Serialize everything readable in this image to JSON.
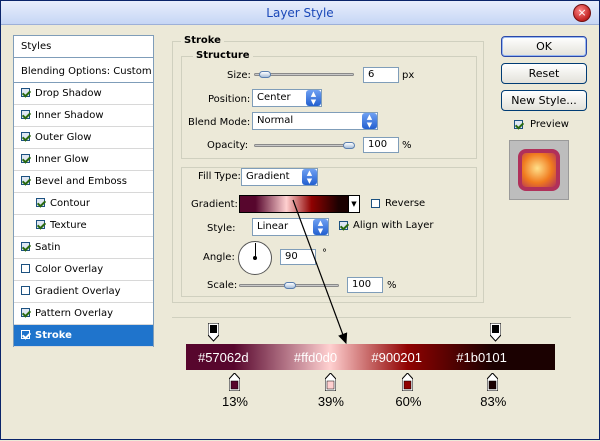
{
  "window": {
    "title": "Layer Style",
    "close_glyph": "×"
  },
  "styles_panel": {
    "heading": "Styles",
    "blending": "Blending Options: Custom",
    "items": [
      {
        "label": "Drop Shadow",
        "checked": true
      },
      {
        "label": "Inner Shadow",
        "checked": true
      },
      {
        "label": "Outer Glow",
        "checked": true
      },
      {
        "label": "Inner Glow",
        "checked": true
      },
      {
        "label": "Bevel and Emboss",
        "checked": true
      },
      {
        "label": "Contour",
        "checked": true
      },
      {
        "label": "Texture",
        "checked": true
      },
      {
        "label": "Satin",
        "checked": true
      },
      {
        "label": "Color Overlay",
        "checked": false
      },
      {
        "label": "Gradient Overlay",
        "checked": false
      },
      {
        "label": "Pattern Overlay",
        "checked": true
      },
      {
        "label": "Stroke",
        "checked": true,
        "selected": true
      }
    ]
  },
  "stroke": {
    "title": "Stroke",
    "structure": {
      "legend": "Structure",
      "size_label": "Size:",
      "size_value": "6",
      "size_unit": "px",
      "size_level": 0.05,
      "position_label": "Position:",
      "position_value": "Center",
      "blend_label": "Blend Mode:",
      "blend_value": "Normal",
      "opacity_label": "Opacity:",
      "opacity_value": "100",
      "opacity_unit": "%",
      "opacity_level": 1.0
    },
    "fill": {
      "fill_type_label": "Fill Type:",
      "fill_type_value": "Gradient",
      "gradient_label": "Gradient:",
      "reverse_label": "Reverse",
      "reverse_checked": false,
      "style_label": "Style:",
      "style_value": "Linear",
      "align_label": "Align with Layer",
      "align_checked": true,
      "angle_label": "Angle:",
      "angle_value": "90",
      "angle_unit": "°",
      "scale_label": "Scale:",
      "scale_value": "100",
      "scale_unit": "%",
      "scale_level": 0.5
    }
  },
  "buttons": {
    "ok": "OK",
    "reset": "Reset",
    "new_style": "New Style...",
    "preview": "Preview",
    "preview_checked": true
  },
  "gradient_editor": {
    "stops": [
      {
        "hex": "#57062d",
        "color": "#57062d",
        "pct": "13%",
        "location": 13
      },
      {
        "hex": "#ffd0d0",
        "color": "#ffd0d0",
        "pct": "39%",
        "location": 39
      },
      {
        "hex": "#900201",
        "color": "#900201",
        "pct": "60%",
        "location": 60
      },
      {
        "hex": "#1b0101",
        "color": "#1b0101",
        "pct": "83%",
        "location": 83
      }
    ]
  }
}
